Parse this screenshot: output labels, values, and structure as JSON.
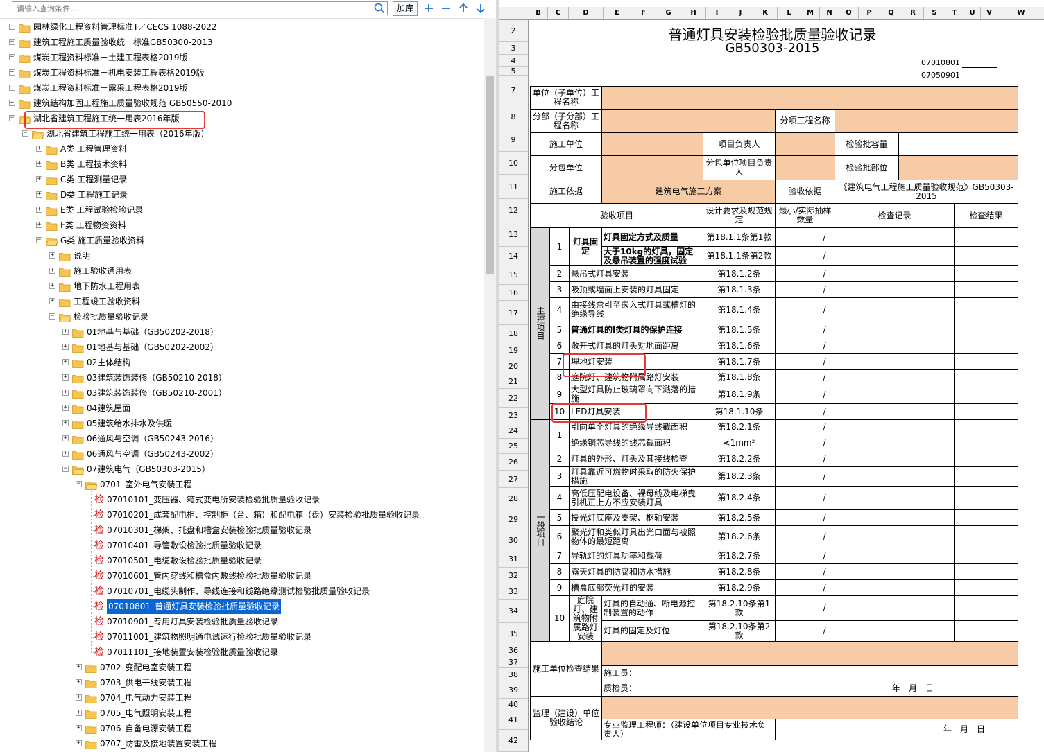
{
  "search": {
    "placeholder": "请输入查询条件...",
    "add_label": "加库"
  },
  "toolbar": {
    "plus": "+",
    "minus": "−",
    "up": "↑",
    "down": "↓"
  },
  "tree": [
    {
      "label": "园林绿化工程资料管理标准T／CECS 1088-2022"
    },
    {
      "label": "建筑工程施工质量验收统一标准GB50300-2013"
    },
    {
      "label": "煤炭工程资料标准－土建工程表格2019版"
    },
    {
      "label": "煤炭工程资料标准－机电安装工程表格2019版"
    },
    {
      "label": "煤炭工程资料标准－露采工程表格2019版"
    },
    {
      "label": "建筑结构加固工程施工质量验收规范 GB50550-2010"
    },
    {
      "label": "湖北省建筑工程施工统一用表2016年版"
    },
    {
      "label": "湖北省建筑工程施工统一用表（2016年版）"
    },
    {
      "label": "A类 工程管理资料"
    },
    {
      "label": "B类 工程技术资料"
    },
    {
      "label": "C类 工程测量记录"
    },
    {
      "label": "D类 工程施工记录"
    },
    {
      "label": "E类 工程试验检验记录"
    },
    {
      "label": "F类 工程物资资料"
    },
    {
      "label": "G类 施工质量验收资料"
    },
    {
      "label": "说明"
    },
    {
      "label": "施工验收通用表"
    },
    {
      "label": "地下防水工程用表"
    },
    {
      "label": "工程竣工验收资料"
    },
    {
      "label": "检验批质量验收记录"
    },
    {
      "label": "01地基与基础（GB50202-2018）"
    },
    {
      "label": "01地基与基础（GB50202-2002）"
    },
    {
      "label": "02主体结构"
    },
    {
      "label": "03建筑装饰装修（GB50210-2018）"
    },
    {
      "label": "03建筑装饰装修（GB50210-2001）"
    },
    {
      "label": "04建筑屋面"
    },
    {
      "label": "05建筑给水排水及供暖"
    },
    {
      "label": "06通风与空调（GB50243-2016）"
    },
    {
      "label": "06通风与空调（GB50243-2002）"
    },
    {
      "label": "07建筑电气（GB50303-2015）"
    },
    {
      "label": "0701_室外电气安装工程"
    },
    {
      "label": "07010101_变压器、箱式变电所安装检验批质量验收记录"
    },
    {
      "label": "07010201_成套配电柜、控制柜（台、箱）和配电箱（盘）安装检验批质量验收记录"
    },
    {
      "label": "07010301_梯架、托盘和槽盒安装检验批质量验收记录"
    },
    {
      "label": "07010401_导管敷设检验批质量验收记录"
    },
    {
      "label": "07010501_电缆敷设检验批质量验收记录"
    },
    {
      "label": "07010601_管内穿线和槽盒内敷线检验批质量验收记录"
    },
    {
      "label": "07010701_电缆头制作、导线连接和线路绝缘测试检验批质量验收记录"
    },
    {
      "label": "07010801_普通灯具安装检验批质量验收记录"
    },
    {
      "label": "07010901_专用灯具安装检验批质量验收记录"
    },
    {
      "label": "07011001_建筑物照明通电试运行检验批质量验收记录"
    },
    {
      "label": "07011101_接地装置安装检验批质量验收记录"
    },
    {
      "label": "0702_变配电室安装工程"
    },
    {
      "label": "0703_供电干线安装工程"
    },
    {
      "label": "0704_电气动力安装工程"
    },
    {
      "label": "0705_电气照明安装工程"
    },
    {
      "label": "0706_自备电源安装工程"
    },
    {
      "label": "0707_防雷及接地装置安装工程"
    }
  ],
  "leaf_tag": "检",
  "sheet": {
    "columns": [
      "B",
      "C",
      "D",
      "E",
      "F",
      "G",
      "H",
      "I",
      "J",
      "K",
      "L",
      "M",
      "N",
      "O",
      "P",
      "Q",
      "R",
      "S",
      "T",
      "U",
      "V",
      "W"
    ],
    "rows": [
      "2",
      "3",
      "4",
      "5",
      "7",
      "8",
      "9",
      "10",
      "11",
      "12",
      "13",
      "14",
      "15",
      "16",
      "17",
      "18",
      "19",
      "20",
      "21",
      "22",
      "23",
      "24",
      "25",
      "26",
      "27",
      "28",
      "29",
      "30",
      "31",
      "32",
      "33",
      "34",
      "35",
      "36",
      "37",
      "38",
      "39",
      "40",
      "41",
      "42"
    ],
    "title": "普通灯具安装检验批质量验收记录",
    "subtitle": "GB50303-2015",
    "code1": "07010801",
    "code2": "07050901",
    "labels": {
      "unit": "单位（子单位）工程名称",
      "sub_part": "分部（子分部）工程名称",
      "sub_item": "分项工程名称",
      "contractor": "施工单位",
      "project_lead": "项目负责人",
      "batch_capacity": "检验批容量",
      "subcontractor": "分包单位",
      "sub_lead": "分包单位项目负责人",
      "batch_part": "检验批部位",
      "basis": "施工依据",
      "basis_value": "建筑电气施工方案",
      "accept_basis": "验收依据",
      "accept_basis_value": "《建筑电气工程施工质量验收规范》GB50303-2015",
      "item": "验收项目",
      "design_req": "设计要求及规范规定",
      "min_sample": "最小/实际抽样数量",
      "check_record": "检查记录",
      "check_result": "检查结果",
      "main_items": "主控项目",
      "general_items": "一般项目",
      "contractor_result": "施工单位检查结果",
      "worker": "施工员：",
      "inspector": "质检员：",
      "date": "年　月　日",
      "supervisor": "监理（建设）单位验收结论",
      "supervisor_eng": "专业监理工程师：（建设单位项目专业技术负责人）",
      "slash": "/"
    },
    "main_rows": [
      {
        "no": "1",
        "group": "灯具固定",
        "name": "灯具固定方式及质量",
        "clause": "第18.1.1条第1款",
        "bold": true
      },
      {
        "no": "",
        "group": "",
        "name": "大于10kg的灯具，固定及悬吊装置的强度试验",
        "clause": "第18.1.1条第2款",
        "bold": true
      },
      {
        "no": "2",
        "name": "悬吊式灯具安装",
        "clause": "第18.1.2条"
      },
      {
        "no": "3",
        "name": "吸顶或墙面上安装的灯具固定",
        "clause": "第18.1.3条"
      },
      {
        "no": "4",
        "name": "由接线盒引至嵌入式灯具或槽灯的绝缘导线",
        "clause": "第18.1.4条"
      },
      {
        "no": "5",
        "name": "普通灯具的I类灯具的保护连接",
        "clause": "第18.1.5条",
        "bold": true
      },
      {
        "no": "6",
        "name": "敞开式灯具的灯头对地面距离",
        "clause": "第18.1.6条"
      },
      {
        "no": "7",
        "name": "埋地灯安装",
        "clause": "第18.1.7条"
      },
      {
        "no": "8",
        "name": "庭院灯、建筑物附属路灯安装",
        "clause": "第18.1.8条"
      },
      {
        "no": "9",
        "name": "大型灯具防止玻璃罩向下溅落的措施",
        "clause": "第18.1.9条"
      },
      {
        "no": "10",
        "name": "LED灯具安装",
        "clause": "第18.1.10条"
      }
    ],
    "general_rows": [
      {
        "no": "1",
        "name": "引向单个灯具的绝缘导线截面积",
        "clause": "第18.2.1条"
      },
      {
        "no": "",
        "name": "绝缘铜芯导线的线芯截面积",
        "clause": "≮1mm²"
      },
      {
        "no": "2",
        "name": "灯具的外形、灯头及其接线检查",
        "clause": "第18.2.2条"
      },
      {
        "no": "3",
        "name": "灯具靠近可燃物时采取的防火保护措施",
        "clause": "第18.2.3条"
      },
      {
        "no": "4",
        "name": "高低压配电设备、裸母线及电梯曳引机正上方不应安装灯具",
        "clause": "第18.2.4条"
      },
      {
        "no": "5",
        "name": "投光灯底座及支架、枢轴安装",
        "clause": "第18.2.5条"
      },
      {
        "no": "6",
        "name": "聚光灯和类似灯具出光口面与被照物体的最短距离",
        "clause": "第18.2.6条"
      },
      {
        "no": "7",
        "name": "导轨灯的灯具功率和载荷",
        "clause": "第18.2.7条"
      },
      {
        "no": "8",
        "name": "露天灯具的防腐和防水措施",
        "clause": "第18.2.8条"
      },
      {
        "no": "9",
        "name": "槽盒底部荧光灯的安装",
        "clause": "第18.2.9条"
      },
      {
        "no": "10",
        "group": "庭院灯、建筑物附属路灯安装",
        "name": "灯具的自动通、断电源控制装置的动作",
        "clause": "第18.2.10条第1款"
      },
      {
        "no": "",
        "group": "",
        "name": "灯具的固定及灯位",
        "clause": "第18.2.10条第2款"
      }
    ]
  },
  "colors": {
    "orange": "#f7cba6",
    "gray": "#d9d9d9",
    "highlight": "#e53935",
    "select": "#0a64d2",
    "folder": "#f6c44f"
  }
}
